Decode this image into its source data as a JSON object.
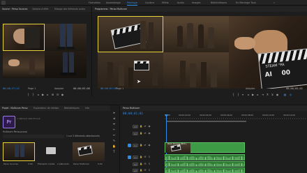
{
  "workspaces": [
    "Formation",
    "Assemblage",
    "Montage",
    "Couleur",
    "Effets",
    "Audio",
    "Images",
    "Bibliothèques",
    "En Montage Tous"
  ],
  "active_workspace": "Montage",
  "source_panel": {
    "tabs": [
      "Source : Perso Sources",
      "Options d'effet",
      "Mixage des éléments audio"
    ],
    "timecode": "00;00;27;12",
    "page_label": "Page 1",
    "zoom_label": "Adapter",
    "duration": "00;00;03;00"
  },
  "program_panel": {
    "tab": "Programme : Perso Multicam",
    "timecode": "00;00;01;01",
    "page_label": "Page 1",
    "fit_label": "Adapter",
    "duration": "00;00;05;02",
    "clapper_text": "STEAM \"PA",
    "clapper_scene": "AI",
    "clapper_take": "00"
  },
  "project_panel": {
    "tabs": [
      "Projet : Multicam Perso",
      "Explorateur de médias",
      "Bibliothèques",
      "Info"
    ],
    "project_name": "Multicam Perso.prproj",
    "selection_info": "1 sur 3 éléments sélectionnés",
    "items": [
      {
        "name": "Perso Sources",
        "duration": "3:00",
        "kind": "clip"
      },
      {
        "name": "Éléments média",
        "duration": "2 éléments",
        "kind": "folder"
      },
      {
        "name": "Perso Multicam",
        "duration": "5:02",
        "kind": "clip"
      }
    ]
  },
  "timeline": {
    "tab": "Perso Multicam",
    "timecode": "00;00;01;01",
    "ruler_labels": [
      "00;00",
      "00;00;02;00",
      "00;00;04;00",
      "00;00;06;00",
      "00;00;08;00",
      "00;00;10;00",
      "00;00;12;00"
    ],
    "video_tracks": [
      "V3",
      "V2",
      "V1"
    ],
    "audio_tracks": [
      "A1",
      "A2",
      "A3"
    ],
    "clip_label": "Perso Sources [MC1]"
  },
  "colors": {
    "accent": "#2d8ceb",
    "clip_green": "#3c9b44",
    "selection_yellow": "#e8d23a",
    "panel_bg": "#1d1d1d"
  }
}
